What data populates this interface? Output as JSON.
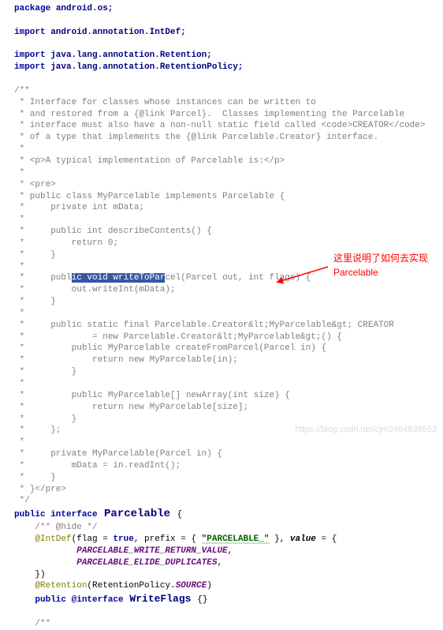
{
  "code": {
    "l1_kw": "package",
    "l1_pkg": " android.os;",
    "l2_kw": "import",
    "l2_pkg": " android.annotation.IntDef;",
    "l3_kw": "import",
    "l3_pkg": " java.lang.annotation.Retention;",
    "l4_kw": "import",
    "l4_pkg": " java.lang.annotation.RetentionPolicy;",
    "c1": "/**",
    "c2": " * Interface for classes whose instances can be written to",
    "c3": " * and restored from a {@link Parcel}.  Classes implementing the Parcelable",
    "c4": " * interface must also have a non-null static field called <code>CREATOR</code>",
    "c5": " * of a type that implements the {@link Parcelable.Creator} interface.",
    "c6": " *",
    "c7": " * <p>A typical implementation of Parcelable is:</p>",
    "c8": " *",
    "c9": " * <pre>",
    "c10": " * public class MyParcelable implements Parcelable {",
    "c11": " *     private int mData;",
    "c12": " *",
    "c13": " *     public int describeContents() {",
    "c14": " *         return 0;",
    "c15": " *     }",
    "c16": " *",
    "c17a": " *     publ",
    "sel": "ic void writeToPar",
    "c17b": "cel(Parcel out, int flags) {",
    "c18": " *         out.writeInt(mData);",
    "c19": " *     }",
    "c20": " *",
    "c21": " *     public static final Parcelable.Creator&lt;MyParcelable&gt; CREATOR",
    "c22": " *             = new Parcelable.Creator&lt;MyParcelable&gt;() {",
    "c23": " *         public MyParcelable createFromParcel(Parcel in) {",
    "c24": " *             return new MyParcelable(in);",
    "c25": " *         }",
    "c26": " *",
    "c27": " *         public MyParcelable[] newArray(int size) {",
    "c28": " *             return new MyParcelable[size];",
    "c29": " *         }",
    "c30": " *     };",
    "c31": " *",
    "c32": " *     private MyParcelable(Parcel in) {",
    "c33": " *         mData = in.readInt();",
    "c34": " *     }",
    "c35": " * }</pre>",
    "c36": " */",
    "l_pub": "public interface",
    "l_parc": " Parcelable ",
    "l_brace": "{",
    "hc1": "    /** @hide */",
    "anno_intdef": "    @IntDef",
    "intdef_args1": "(flag = ",
    "intdef_true": "true",
    "intdef_args2": ", prefix = { ",
    "intdef_str": "\"PARCELABLE_\"",
    "intdef_args3": " }, ",
    "intdef_value": "value",
    "intdef_args4": " = {",
    "const1": "            PARCELABLE_WRITE_RETURN_VALUE",
    "const1_comma": ",",
    "const2": "            PARCELABLE_ELIDE_DUPLICATES",
    "const2_comma": ",",
    "close_brace": "    })",
    "anno_ret": "    @Retention",
    "ret_args1": "(RetentionPolicy.",
    "ret_src": "SOURCE",
    "ret_args2": ")",
    "l_pub2": "    public @interface",
    "l_wf": " WriteFlags ",
    "l_wf_brace": "{}",
    "hc2": "    /**"
  },
  "annotation": {
    "line1": "这里说明了如何去实现",
    "line2": "Parcelable"
  },
  "watermark": "https://blog.csdn.net/cjm2484836553"
}
